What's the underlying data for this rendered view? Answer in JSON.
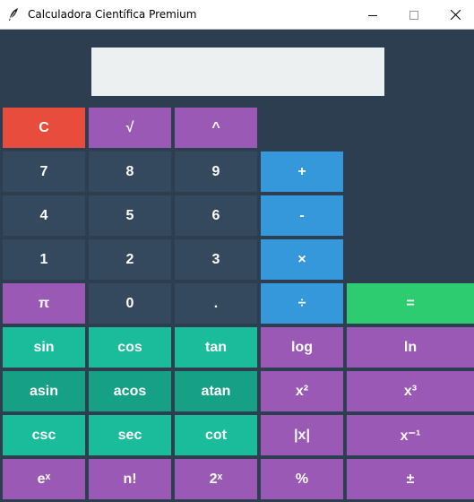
{
  "window": {
    "title": "Calculadora Científica Premium",
    "icon": "feather-icon",
    "controls": [
      "minimize-icon",
      "maximize-icon",
      "close-icon"
    ]
  },
  "display": {
    "value": ""
  },
  "buttons": {
    "clear": "C",
    "sqrt": "√",
    "power": "^",
    "n7": "7",
    "n8": "8",
    "n9": "9",
    "plus": "+",
    "n4": "4",
    "n5": "5",
    "n6": "6",
    "minus": "-",
    "n1": "1",
    "n2": "2",
    "n3": "3",
    "multiply": "×",
    "pi": "π",
    "n0": "0",
    "dot": ".",
    "divide": "÷",
    "equals": "=",
    "sin": "sin",
    "cos": "cos",
    "tan": "tan",
    "log": "log",
    "ln": "ln",
    "asin": "asin",
    "acos": "acos",
    "atan": "atan",
    "square": "x²",
    "cube": "x³",
    "csc": "csc",
    "sec": "sec",
    "cot": "cot",
    "abs": "|x|",
    "inverse": "x⁻¹",
    "exp": "eˣ",
    "factorial": "n!",
    "pow2": "2ˣ",
    "percent": "%",
    "plusminus": "±"
  },
  "colors": {
    "background": "#2c3e50",
    "display": "#ecf0f1",
    "number": "#34495e",
    "clear": "#e74c3c",
    "function": "#9b59b6",
    "operator": "#3498db",
    "equals": "#2ecc71",
    "trig": "#1abc9c",
    "trig_inverse": "#16a085"
  }
}
